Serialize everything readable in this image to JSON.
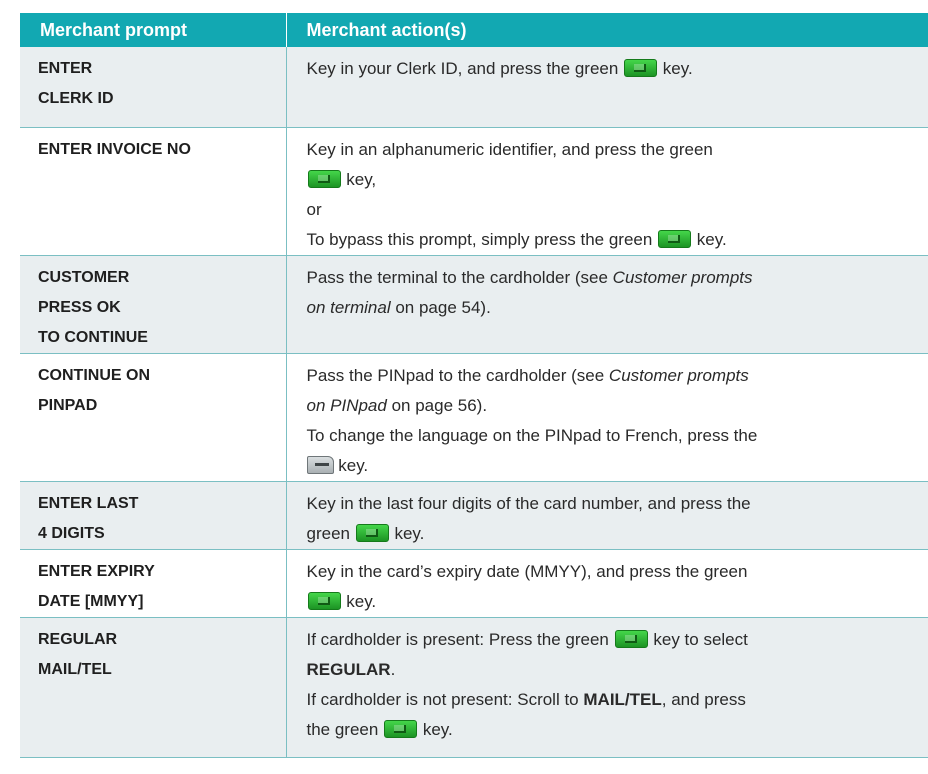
{
  "table": {
    "headers": {
      "prompt": "Merchant prompt",
      "action": "Merchant action(s)"
    },
    "rows": [
      {
        "prompt": [
          "ENTER",
          "CLERK ID"
        ],
        "action": {
          "l1a": "Key in your Clerk ID, and press the green",
          "l1b": "key."
        }
      },
      {
        "prompt": [
          "ENTER INVOICE NO"
        ],
        "action": {
          "l1": "Key in an alphanumeric identifier, and press the green",
          "l2b": "key,",
          "l3": "or",
          "l4a": "To bypass this prompt, simply press the green",
          "l4b": "key."
        }
      },
      {
        "prompt": [
          "CUSTOMER",
          "PRESS OK",
          "TO CONTINUE"
        ],
        "action": {
          "l1a": "Pass the terminal to the cardholder (see",
          "l1i": "Customer prompts",
          "l2i": "on terminal",
          "l2b": "on page 54)."
        }
      },
      {
        "prompt": [
          "CONTINUE ON",
          "PINPAD"
        ],
        "action": {
          "l1a": "Pass the PINpad to the cardholder (see",
          "l1i": "Customer prompts",
          "l2i": "on PINpad",
          "l2b": "on page 56).",
          "l3": "To change the language on the PINpad to French, press the",
          "l4b": "key."
        }
      },
      {
        "prompt": [
          "ENTER LAST",
          "4 DIGITS"
        ],
        "action": {
          "l1": "Key in the last four digits of the card number, and press the",
          "l2a": "green",
          "l2b": "key."
        }
      },
      {
        "prompt": [
          "ENTER EXPIRY",
          "DATE [MMYY]"
        ],
        "action": {
          "l1": "Key in the card’s expiry date (MMYY), and press the green",
          "l2b": "key."
        }
      },
      {
        "prompt": [
          "REGULAR",
          "MAIL/TEL"
        ],
        "action": {
          "l1a": "If cardholder is present: Press the green",
          "l1b": "key to select",
          "l2bold": "REGULAR",
          "l2b": ".",
          "l3a": "If cardholder is not present: Scroll to",
          "l3bold": "MAIL/TEL",
          "l3b": ", and press",
          "l4a": "the green",
          "l4b": "key."
        }
      }
    ]
  },
  "icons": {
    "ok_key": "green-ok-key-icon",
    "lang_key": "grey-language-key-icon"
  },
  "colors": {
    "header_bg": "#12a8b2",
    "header_text": "#ffffff",
    "shaded_row": "#e9eef0",
    "rule": "#7bbfc3"
  }
}
